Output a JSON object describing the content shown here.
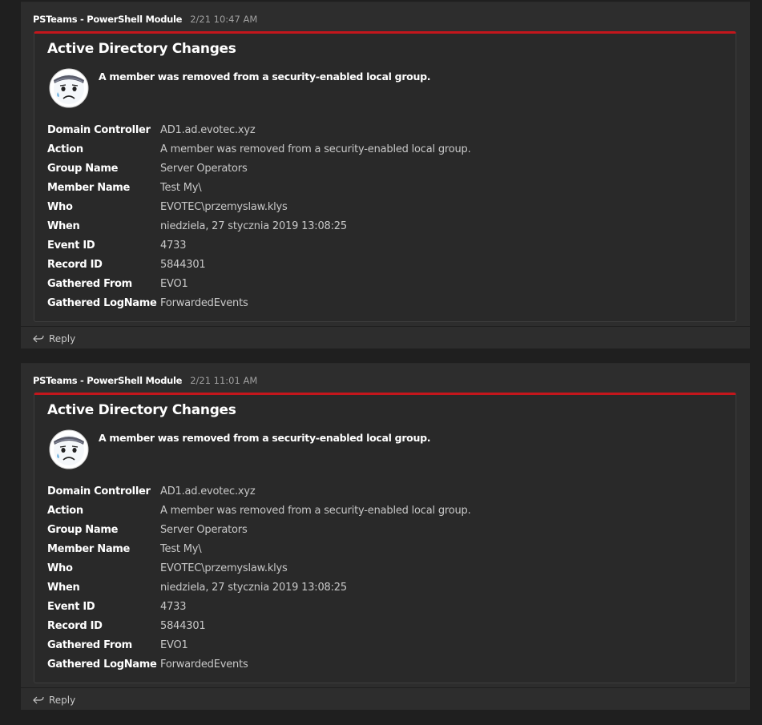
{
  "messages": [
    {
      "sender": "PSTeams - PowerShell Module",
      "timestamp": "2/21 10:47 AM",
      "card": {
        "title": "Active Directory Changes",
        "summary": "A member was removed from a security-enabled local group.",
        "avatar_icon": "sad-face-icon",
        "accent_color": "#c4161c",
        "facts": [
          {
            "label": "Domain Controller",
            "value": "AD1.ad.evotec.xyz"
          },
          {
            "label": "Action",
            "value": "A member was removed from a security-enabled local group."
          },
          {
            "label": "Group Name",
            "value": "Server Operators"
          },
          {
            "label": "Member Name",
            "value": "Test My\\"
          },
          {
            "label": "Who",
            "value": "EVOTEC\\przemyslaw.klys"
          },
          {
            "label": "When",
            "value": "niedziela, 27 stycznia 2019 13:08:25"
          },
          {
            "label": "Event ID",
            "value": "4733"
          },
          {
            "label": "Record ID",
            "value": "5844301"
          },
          {
            "label": "Gathered From",
            "value": "EVO1"
          },
          {
            "label": "Gathered LogName",
            "value": "ForwardedEvents"
          }
        ]
      },
      "reply_label": "Reply"
    },
    {
      "sender": "PSTeams - PowerShell Module",
      "timestamp": "2/21 11:01 AM",
      "card": {
        "title": "Active Directory Changes",
        "summary": "A member was removed from a security-enabled local group.",
        "avatar_icon": "sad-face-icon",
        "accent_color": "#c4161c",
        "facts": [
          {
            "label": "Domain Controller",
            "value": "AD1.ad.evotec.xyz"
          },
          {
            "label": "Action",
            "value": "A member was removed from a security-enabled local group."
          },
          {
            "label": "Group Name",
            "value": "Server Operators"
          },
          {
            "label": "Member Name",
            "value": "Test My\\"
          },
          {
            "label": "Who",
            "value": "EVOTEC\\przemyslaw.klys"
          },
          {
            "label": "When",
            "value": "niedziela, 27 stycznia 2019 13:08:25"
          },
          {
            "label": "Event ID",
            "value": "4733"
          },
          {
            "label": "Record ID",
            "value": "5844301"
          },
          {
            "label": "Gathered From",
            "value": "EVO1"
          },
          {
            "label": "Gathered LogName",
            "value": "ForwardedEvents"
          }
        ]
      },
      "reply_label": "Reply"
    }
  ]
}
